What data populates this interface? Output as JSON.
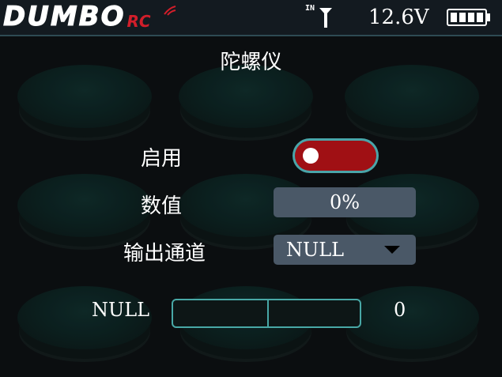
{
  "header": {
    "logo_text": "DUMBO",
    "logo_suffix": "RC",
    "signal_label": "IN",
    "voltage": "12.6V",
    "battery_level": 1.0
  },
  "page": {
    "title": "陀螺仪"
  },
  "settings": {
    "enable": {
      "label": "启用",
      "state": "off"
    },
    "value": {
      "label": "数值",
      "display": "0%"
    },
    "output_channel": {
      "label": "输出通道",
      "selected": "NULL"
    }
  },
  "channel_bar": {
    "label": "NULL",
    "value": "0"
  },
  "colors": {
    "accent": "#48a8a6",
    "toggle_off": "#a01014",
    "box": "#4a5867",
    "header_bg": "#131a20"
  }
}
